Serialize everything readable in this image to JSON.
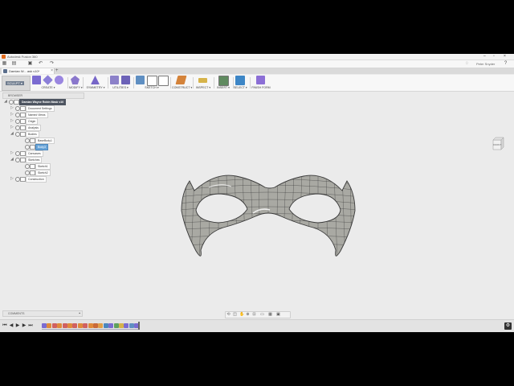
{
  "app": {
    "window_title": "Autodesk Fusion 360",
    "user": "Peter Snyder"
  },
  "tab": {
    "label": "Damian W... ask v10*",
    "add": "+"
  },
  "toolbar": {
    "workspace": "SCULPT ▾",
    "groups": [
      "CREATE ▾",
      "MODIFY ▾",
      "SYMMETRY ▾",
      "UTILITIES ▾",
      "SKETCH ▾",
      "CONSTRUCT ▾",
      "INSPECT ▾",
      "INSERT ▾",
      "SELECT ▾",
      "FINISH FORM"
    ]
  },
  "browser": {
    "title": "BROWSER",
    "root": "Damian Wayne Robin Mask v10",
    "items": [
      {
        "label": "Document Settings",
        "level": 1
      },
      {
        "label": "Named Views",
        "level": 1
      },
      {
        "label": "Origin",
        "level": 1
      },
      {
        "label": "Analysis",
        "level": 1
      },
      {
        "label": "Bodies",
        "level": 1
      },
      {
        "label": "BaseBody1",
        "level": 2
      },
      {
        "label": "Body3",
        "level": 2
      },
      {
        "label": "Canvases",
        "level": 1
      },
      {
        "label": "Sketches",
        "level": 1
      },
      {
        "label": "Sketch1",
        "level": 2
      },
      {
        "label": "Sketch2",
        "level": 2
      },
      {
        "label": "Construction",
        "level": 1
      }
    ]
  },
  "viewcube": {
    "face": "FRONT"
  },
  "comments": {
    "title": "COMMENTS"
  },
  "colors": {
    "background": "#ebebeb",
    "mask_fill": "#a9a9a3",
    "accent_blue": "#3d86c6"
  }
}
